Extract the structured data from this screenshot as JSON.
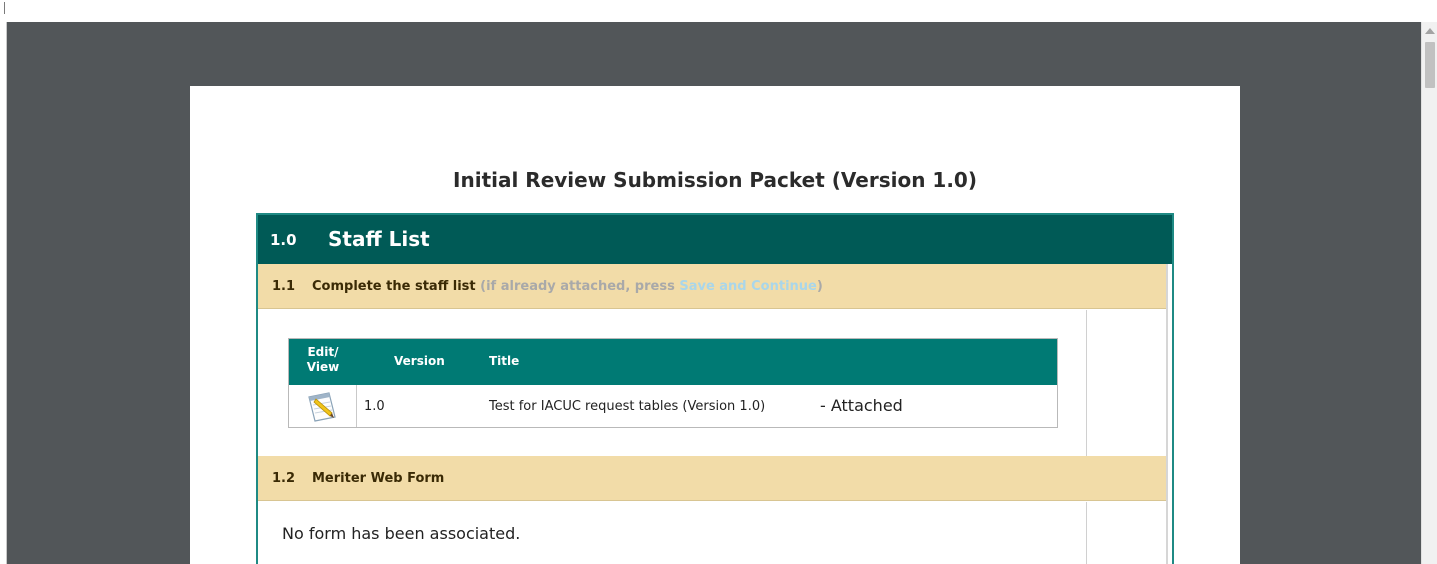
{
  "document": {
    "title": "Initial Review Submission Packet (Version 1.0)"
  },
  "section": {
    "number": "1.0",
    "title": "Staff List"
  },
  "subsections": [
    {
      "number": "1.1",
      "title": "Complete the staff list",
      "hint_prefix": "(if already attached, press ",
      "hint_link": "Save and Continue",
      "hint_suffix": ")",
      "table": {
        "headers": {
          "edit_view_line1": "Edit/",
          "edit_view_line2": "View",
          "version": "Version",
          "title": "Title"
        },
        "rows": [
          {
            "icon": "notepad-icon",
            "version": "1.0",
            "title": "Test for IACUC request tables (Version 1.0)",
            "status": "- Attached"
          }
        ]
      }
    },
    {
      "number": "1.2",
      "title": "Meriter Web Form",
      "body_text": "No form has been associated."
    }
  ],
  "colors": {
    "viewer_background": "#525659",
    "section_header": "#005a56",
    "table_header": "#007a74",
    "subsection_header": "#f2dca8",
    "hint_text": "#a9a9a9",
    "hint_link": "#a9d6ea"
  }
}
